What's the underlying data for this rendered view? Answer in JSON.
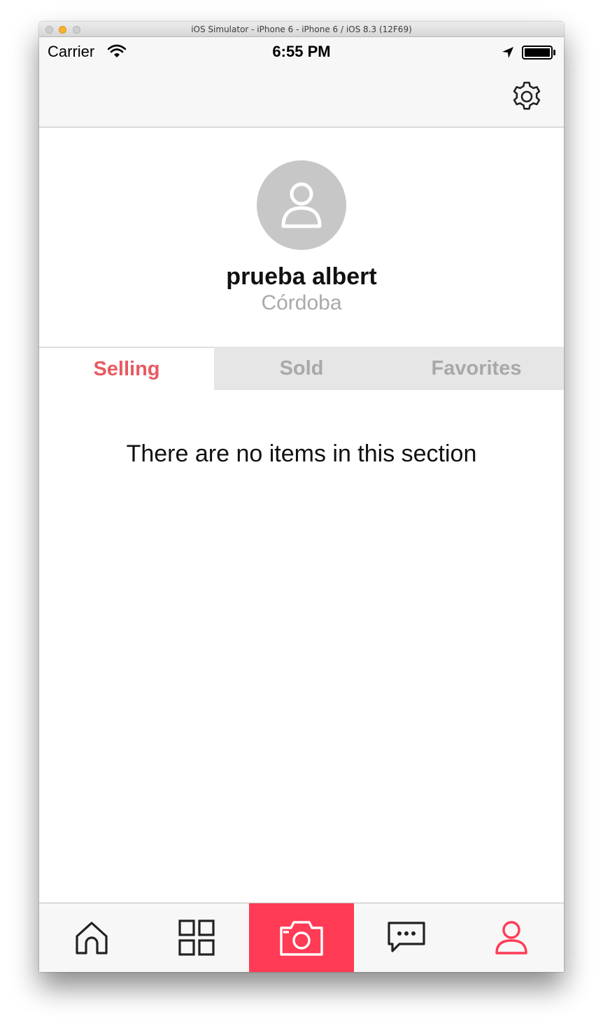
{
  "window": {
    "title": "iOS Simulator - iPhone 6 - iPhone 6 / iOS 8.3 (12F69)"
  },
  "status_bar": {
    "carrier": "Carrier",
    "time": "6:55 PM"
  },
  "nav_bar": {
    "right_icon": "gear-icon"
  },
  "profile": {
    "name": "prueba albert",
    "location": "Córdoba",
    "avatar_icon": "user-icon"
  },
  "tabs": [
    {
      "label": "Selling",
      "active": true
    },
    {
      "label": "Sold",
      "active": false
    },
    {
      "label": "Favorites",
      "active": false
    }
  ],
  "content": {
    "empty_message": "There are no items in this section"
  },
  "tab_bar": {
    "items": [
      {
        "icon": "home-icon"
      },
      {
        "icon": "grid-icon"
      },
      {
        "icon": "camera-icon"
      },
      {
        "icon": "chat-icon"
      },
      {
        "icon": "profile-icon",
        "active": true
      }
    ]
  },
  "colors": {
    "accent": "#e85a62",
    "camera_bg": "#ff3b55",
    "inactive_text": "#a8a8a8",
    "avatar_bg": "#c7c7c7"
  }
}
